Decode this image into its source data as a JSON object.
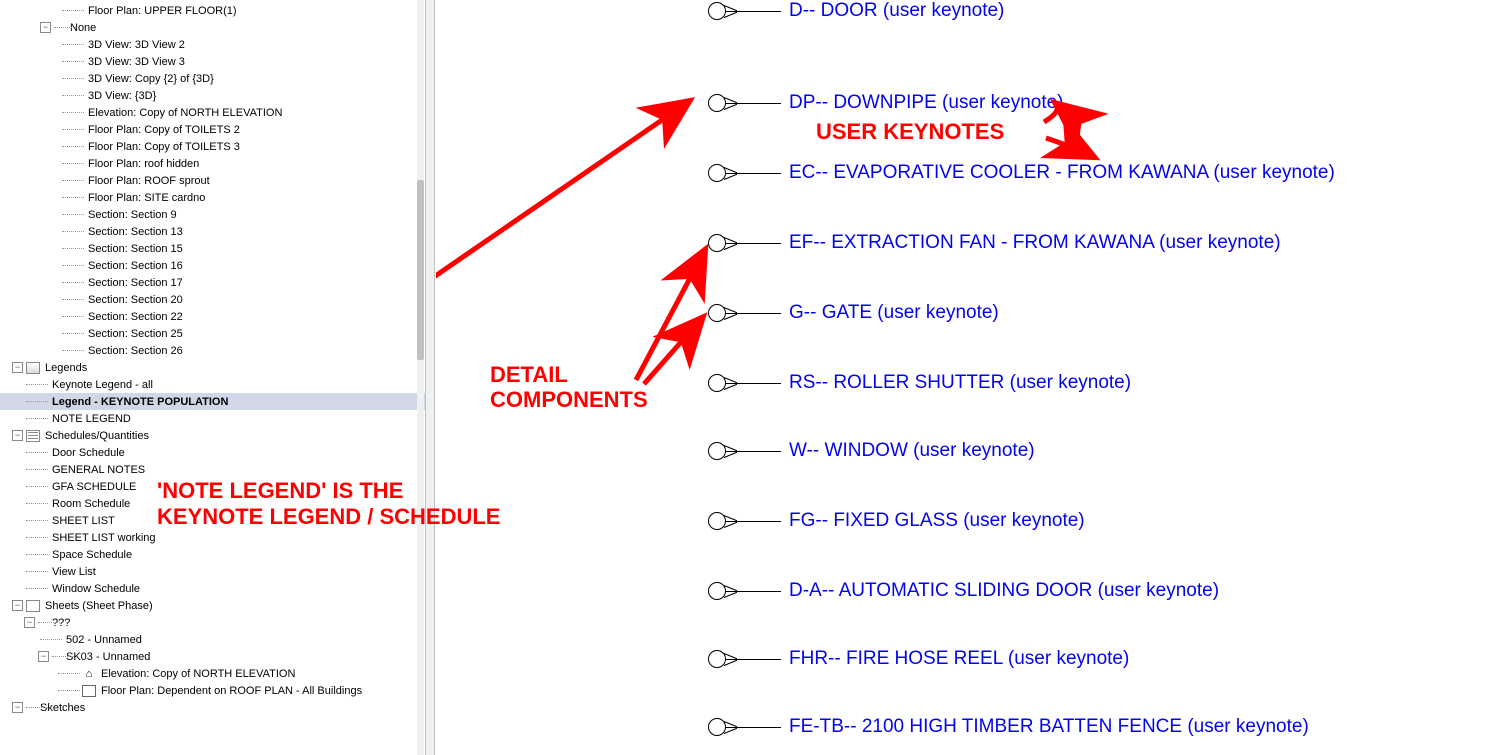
{
  "orphan_top": "Floor Plan: UPPER FLOOR(1)",
  "none_label": "None",
  "none_items": [
    "3D View: 3D View 2",
    "3D View: 3D View 3",
    "3D View: Copy {2} of {3D}",
    "3D View: {3D}",
    "Elevation: Copy of NORTH ELEVATION",
    "Floor Plan: Copy of TOILETS 2",
    "Floor Plan: Copy of TOILETS 3",
    "Floor Plan: roof hidden",
    "Floor Plan: ROOF sprout",
    "Floor Plan: SITE cardno",
    "Section: Section 9",
    "Section: Section 13",
    "Section: Section 15",
    "Section: Section 16",
    "Section: Section 17",
    "Section: Section 20",
    "Section: Section 22",
    "Section: Section 25",
    "Section: Section 26"
  ],
  "legends_label": "Legends",
  "legends_items": [
    "Keynote Legend - all",
    "Legend - KEYNOTE POPULATION",
    "NOTE LEGEND"
  ],
  "schedules_label": "Schedules/Quantities",
  "schedules_items": [
    "Door Schedule",
    "GENERAL NOTES",
    "GFA SCHEDULE",
    "Room Schedule",
    "SHEET LIST",
    "SHEET LIST working",
    "Space Schedule",
    "View List",
    "Window Schedule"
  ],
  "sheets_label": "Sheets (Sheet Phase)",
  "sheets_q": "???",
  "sheets_items": [
    "502 - Unnamed",
    "SK03 - Unnamed"
  ],
  "sheet_children": [
    "Elevation: Copy of NORTH ELEVATION",
    "Floor Plan: Dependent on ROOF PLAN - All Buildings"
  ],
  "sketches_label": "Sketches",
  "keynotes": [
    "D-- DOOR (user keynote)",
    "DP-- DOWNPIPE (user keynote)",
    "EC-- EVAPORATIVE COOLER - FROM KAWANA (user keynote)",
    "EF-- EXTRACTION FAN - FROM KAWANA (user keynote)",
    "G-- GATE (user keynote)",
    "RS-- ROLLER SHUTTER (user keynote)",
    "W-- WINDOW (user keynote)",
    "FG-- FIXED GLASS (user keynote)",
    "D-A-- AUTOMATIC SLIDING DOOR (user keynote)",
    "FHR-- FIRE HOSE REEL (user keynote)",
    "FE-TB-- 2100 HIGH TIMBER BATTEN FENCE (user keynote)"
  ],
  "annotations": {
    "user_keynotes": "USER KEYNOTES",
    "detail_components": "DETAIL\nCOMPONENTS",
    "note_legend": "'NOTE LEGEND' IS THE\nKEYNOTE LEGEND / SCHEDULE"
  }
}
